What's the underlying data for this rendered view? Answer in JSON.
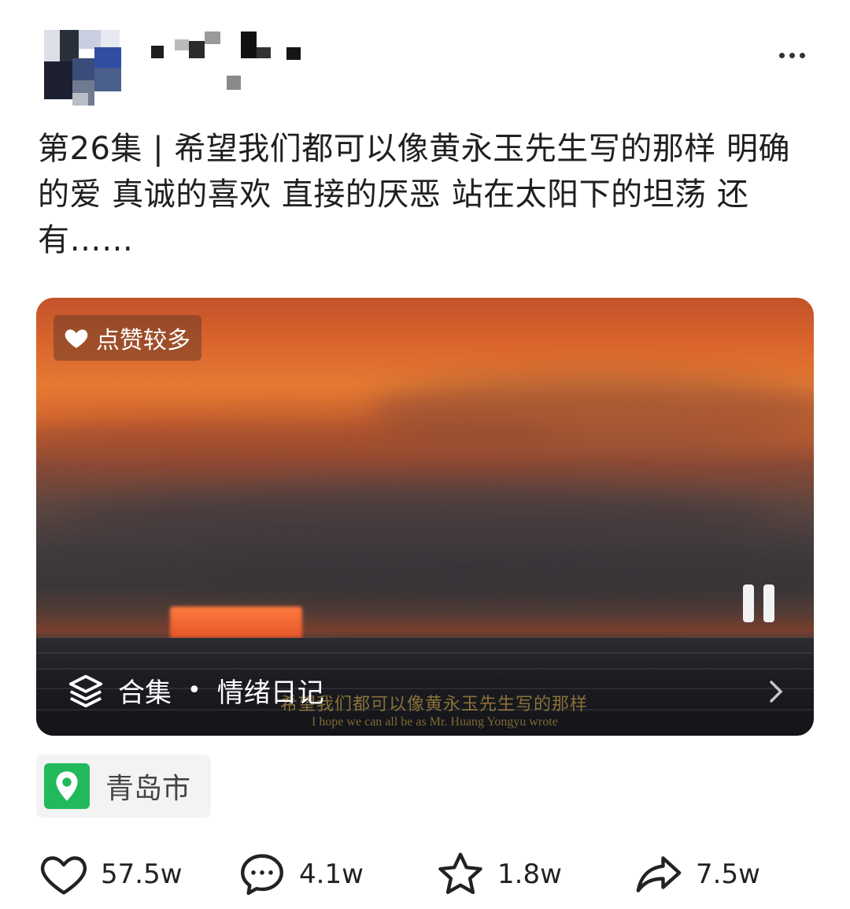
{
  "post": {
    "text": "第26集 | 希望我们都可以像黄永玉先生写的那样 明确的爱 真诚的喜欢 直接的厌恶 站在太阳下的坦荡 还有……"
  },
  "video": {
    "badge_label": "点赞较多",
    "collection_label": "合集",
    "collection_name": "情绪日记",
    "subtitle_cn": "希望我们都可以像黄永玉先生写的那样",
    "subtitle_en": "I hope we can all be as Mr. Huang Yongyu wrote"
  },
  "location": {
    "name": "青岛市"
  },
  "actions": {
    "likes": "57.5w",
    "comments": "4.1w",
    "favorites": "1.8w",
    "shares": "7.5w"
  },
  "icons": {
    "header_more": "more-dots-icon",
    "badge": "heart-icon",
    "collection": "layers-icon",
    "location": "location-pin-icon",
    "like": "heart-outline-icon",
    "comment": "comment-bubble-icon",
    "favorite": "star-outline-icon",
    "share": "share-arrow-icon"
  },
  "colors": {
    "location_green": "#22b95b",
    "sunset_orange": "#e57a33"
  }
}
